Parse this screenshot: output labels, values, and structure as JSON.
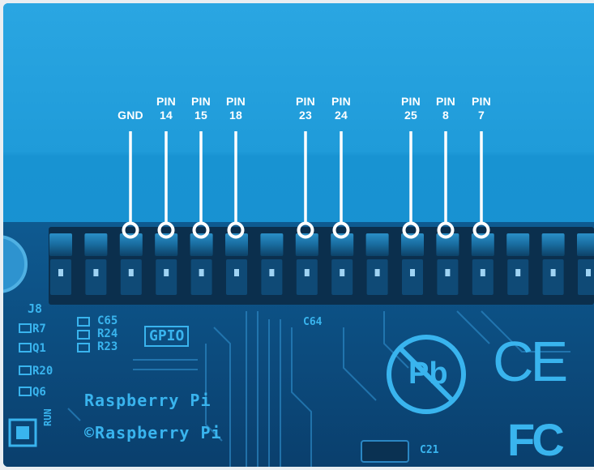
{
  "pins": [
    {
      "top": "",
      "bottom": "GND"
    },
    {
      "top": "PIN",
      "bottom": "14"
    },
    {
      "top": "PIN",
      "bottom": "15"
    },
    {
      "top": "PIN",
      "bottom": "18"
    },
    {
      "top": "PIN",
      "bottom": "23"
    },
    {
      "top": "PIN",
      "bottom": "24"
    },
    {
      "top": "PIN",
      "bottom": "25"
    },
    {
      "top": "PIN",
      "bottom": "8"
    },
    {
      "top": "PIN",
      "bottom": "7"
    }
  ],
  "board": {
    "header_ref": "J8",
    "gpio_label": "GPIO",
    "components": [
      "R7",
      "Q1",
      "R20",
      "Q6",
      "C65",
      "R24",
      "R23",
      "C64",
      "C21"
    ],
    "brand_line1": "Raspberry Pi",
    "brand_line2": "©Raspberry Pi",
    "run_label": "RUN",
    "pb_mark": "Pb",
    "ce_mark": "CE",
    "fcc_mark": "FC"
  },
  "colors": {
    "sky": "#1d98d6",
    "board": "#0d4d80",
    "header": "#0b2f4d",
    "silkscreen": "#39b4ee",
    "callout": "#ffffff"
  }
}
